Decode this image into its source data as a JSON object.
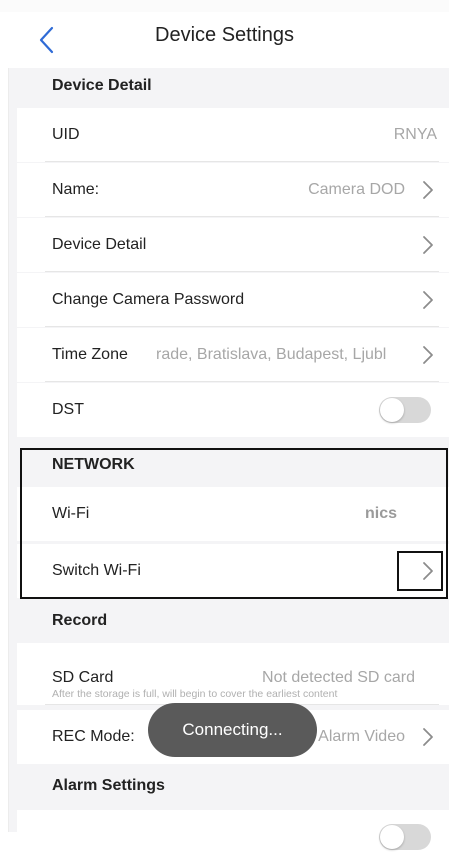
{
  "header": {
    "title": "Device Settings",
    "back_icon": "chevron-left-icon"
  },
  "sections": {
    "device_detail": {
      "title": "Device Detail",
      "uid": {
        "label": "UID",
        "value": "RNYA"
      },
      "name": {
        "label": "Name:",
        "value": "Camera DOD"
      },
      "device_detail": {
        "label": "Device Detail"
      },
      "change_password": {
        "label": "Change Camera Password"
      },
      "time_zone": {
        "label": "Time Zone",
        "value": "rade, Bratislava, Budapest, Ljubl"
      },
      "dst": {
        "label": "DST",
        "enabled": false
      }
    },
    "network": {
      "title": "NETWORK",
      "wifi": {
        "label": "Wi-Fi",
        "value": "nics"
      },
      "switch_wifi": {
        "label": "Switch Wi-Fi"
      }
    },
    "record": {
      "title": "Record",
      "sd_card": {
        "label": "SD Card",
        "value": "Not detected SD card",
        "hint": "After the storage is full, will begin to cover the earliest content"
      },
      "rec_mode": {
        "label": "REC Mode:",
        "value": "Alarm Video"
      }
    },
    "alarm": {
      "title": "Alarm Settings"
    }
  },
  "toast": {
    "text": "Connecting..."
  },
  "colors": {
    "accent": "#2f6bd6",
    "toggle_off": "#d8d8d8",
    "toast_bg": "#5a5a5a"
  }
}
